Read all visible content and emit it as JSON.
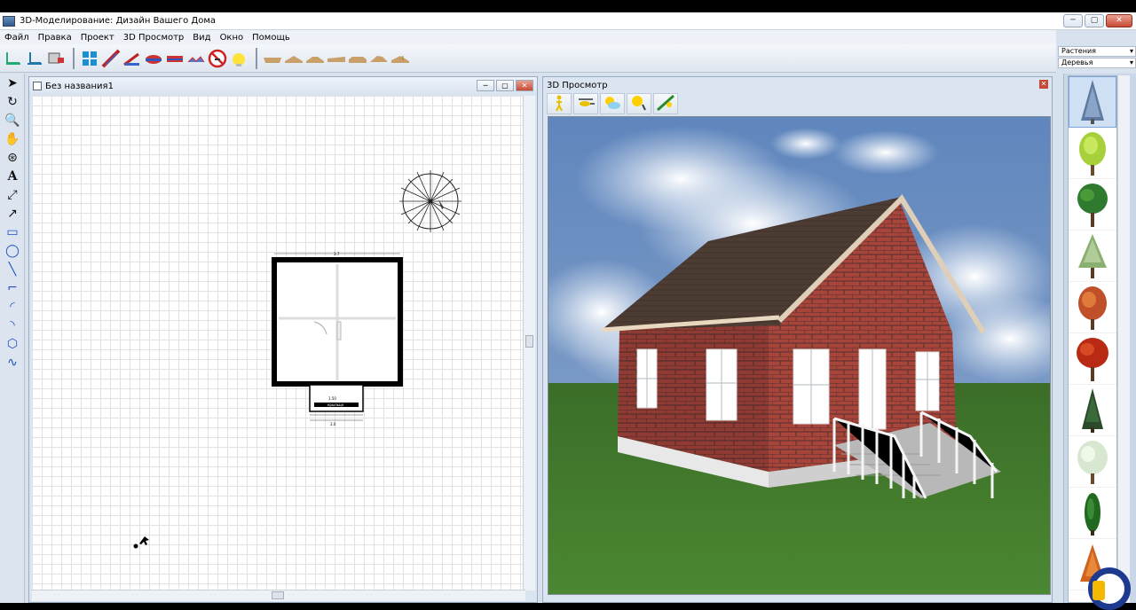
{
  "window": {
    "title": "3D-Моделирование: Дизайн Вашего Дома",
    "btn_min": "─",
    "btn_max": "▢",
    "btn_close": "✕"
  },
  "menu": [
    "Файл",
    "Правка",
    "Проект",
    "3D Просмотр",
    "Вид",
    "Окно",
    "Помощь"
  ],
  "right_panel": {
    "category": "Растения",
    "subcategory": "Деревья"
  },
  "plan_window": {
    "title": "Без названия1",
    "btn_min": "─",
    "btn_max": "▢",
    "btn_close": "✕"
  },
  "view3d_window": {
    "title": "3D Просмотр",
    "btn_close": "✕"
  },
  "view3d_tools": [
    "walk-icon",
    "helicopter-icon",
    "sun-cloud-icon",
    "light-icon",
    "landscape-icon"
  ],
  "tree_icons": [
    "blue-spruce",
    "light-green-tree",
    "oak-tree",
    "pine-tree",
    "autumn-orange-tree",
    "red-maple-tree",
    "dark-fir-tree",
    "white-blossom-tree",
    "cypress-tree",
    "autumn-red-bush"
  ],
  "plan": {
    "dim_top": "3.7",
    "dim_porch": "1.50",
    "porch_label": "крыльцо",
    "dim_bottom": "3.0"
  },
  "colors": {
    "brick": "#9a3b34",
    "roof": "#4a3a32",
    "grass": "#3f7a2a",
    "sky": "#7a9cc8"
  }
}
